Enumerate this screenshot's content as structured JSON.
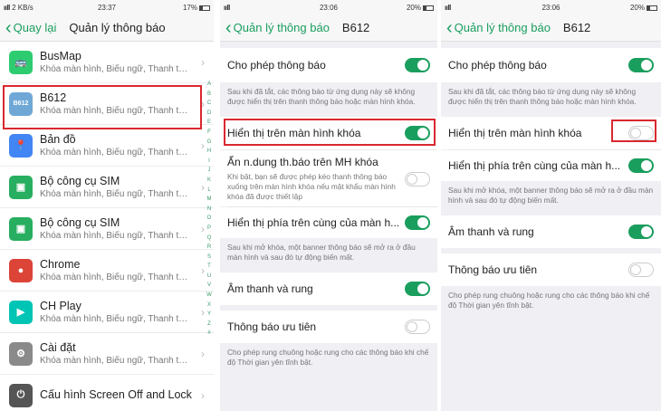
{
  "panel1": {
    "status": {
      "signal": "ııll",
      "speed": "2 KB/s",
      "time": "23:37",
      "battery": "17%"
    },
    "back_label": "Quay lại",
    "title": "Quản lý thông báo",
    "apps": [
      {
        "name": "BusMap",
        "sub": "Khóa màn hình, Biểu ngữ, Thanh thông báo",
        "icon": "busmap-icon",
        "color": "#2ecc71",
        "glyph": "🚌"
      },
      {
        "name": "B612",
        "sub": "Khóa màn hình, Biểu ngữ, Thanh thông báo",
        "icon": "b612-icon",
        "color": "#6fa8d6",
        "glyph": "B612"
      },
      {
        "name": "Bản đồ",
        "sub": "Khóa màn hình, Biểu ngữ, Thanh thông báo",
        "icon": "maps-icon",
        "color": "#4285f4",
        "glyph": "📍"
      },
      {
        "name": "Bộ công cụ SIM",
        "sub": "Khóa màn hình, Biểu ngữ, Thanh thông báo",
        "icon": "sim-toolkit-icon",
        "color": "#27ae60",
        "glyph": "▣"
      },
      {
        "name": "Bộ công cụ SIM",
        "sub": "Khóa màn hình, Biểu ngữ, Thanh thông báo",
        "icon": "sim-toolkit-icon",
        "color": "#27ae60",
        "glyph": "▣"
      },
      {
        "name": "Chrome",
        "sub": "Khóa màn hình, Biểu ngữ, Thanh thông báo",
        "icon": "chrome-icon",
        "color": "#db4437",
        "glyph": "●"
      },
      {
        "name": "CH Play",
        "sub": "Khóa màn hình, Biểu ngữ, Thanh thông báo",
        "icon": "play-store-icon",
        "color": "#00c4b4",
        "glyph": "▶"
      },
      {
        "name": "Cài đặt",
        "sub": "Khóa màn hình, Biểu ngữ, Thanh thông báo",
        "icon": "settings-icon",
        "color": "#8a8a8a",
        "glyph": "⚙"
      },
      {
        "name": "Cấu hình Screen Off and Lock",
        "sub": "",
        "icon": "screen-off-icon",
        "color": "#555555",
        "glyph": "⏻"
      }
    ],
    "alphabet": [
      "A",
      "B",
      "C",
      "D",
      "E",
      "F",
      "G",
      "H",
      "I",
      "J",
      "K",
      "L",
      "M",
      "N",
      "O",
      "P",
      "Q",
      "R",
      "S",
      "T",
      "U",
      "V",
      "W",
      "X",
      "Y",
      "Z",
      "#"
    ]
  },
  "panel2": {
    "status": {
      "signal": "ııll",
      "speed": "",
      "time": "23:06",
      "battery": "20%"
    },
    "back_label": "Quản lý thông báo",
    "title": "B612",
    "allow_label": "Cho phép thông báo",
    "allow_desc": "Sau khi đã tắt, các thông báo từ ứng dụng này sẽ không được hiển thị trên thanh thông báo hoặc màn hình khóa.",
    "lockscreen_label": "Hiển thị trên màn hình khóa",
    "hide_content_label": "Ẩn n.dung th.báo trên MH khóa",
    "hide_content_desc": "Khi bật, bạn sẽ được phép kéo thanh thông báo xuống trên màn hình khóa nếu mật khẩu màn hình khóa đã được thiết lập",
    "top_label": "Hiển thị phía trên cùng của màn h...",
    "top_desc": "Sau khi mở khóa, một banner thông báo sẽ mở ra ở đầu màn hình và sau đó tự động biến mất.",
    "sound_label": "Âm thanh và rung",
    "priority_label": "Thông báo ưu tiên",
    "priority_desc": "Cho phép rung chuông hoặc rung cho các thông báo khi chế độ Thời gian yên tĩnh bật."
  },
  "panel3": {
    "status": {
      "signal": "ııll",
      "speed": "",
      "time": "23:06",
      "battery": "20%"
    },
    "back_label": "Quản lý thông báo",
    "title": "B612",
    "allow_label": "Cho phép thông báo",
    "allow_desc": "Sau khi đã tắt, các thông báo từ ứng dụng này sẽ không được hiển thị trên thanh thông báo hoặc màn hình khóa.",
    "lockscreen_label": "Hiển thị trên màn hình khóa",
    "top_label": "Hiển thị phía trên cùng của màn h...",
    "top_desc": "Sau khi mở khóa, một banner thông báo sẽ mở ra ở đầu màn hình và sau đó tự động biến mất.",
    "sound_label": "Âm thanh và rung",
    "priority_label": "Thông báo ưu tiên",
    "priority_desc": "Cho phép rung chuông hoặc rung cho các thông báo khi chế độ Thời gian yên tĩnh bật."
  },
  "colors": {
    "accent": "#1a9e5e",
    "highlight": "#d9282f"
  }
}
